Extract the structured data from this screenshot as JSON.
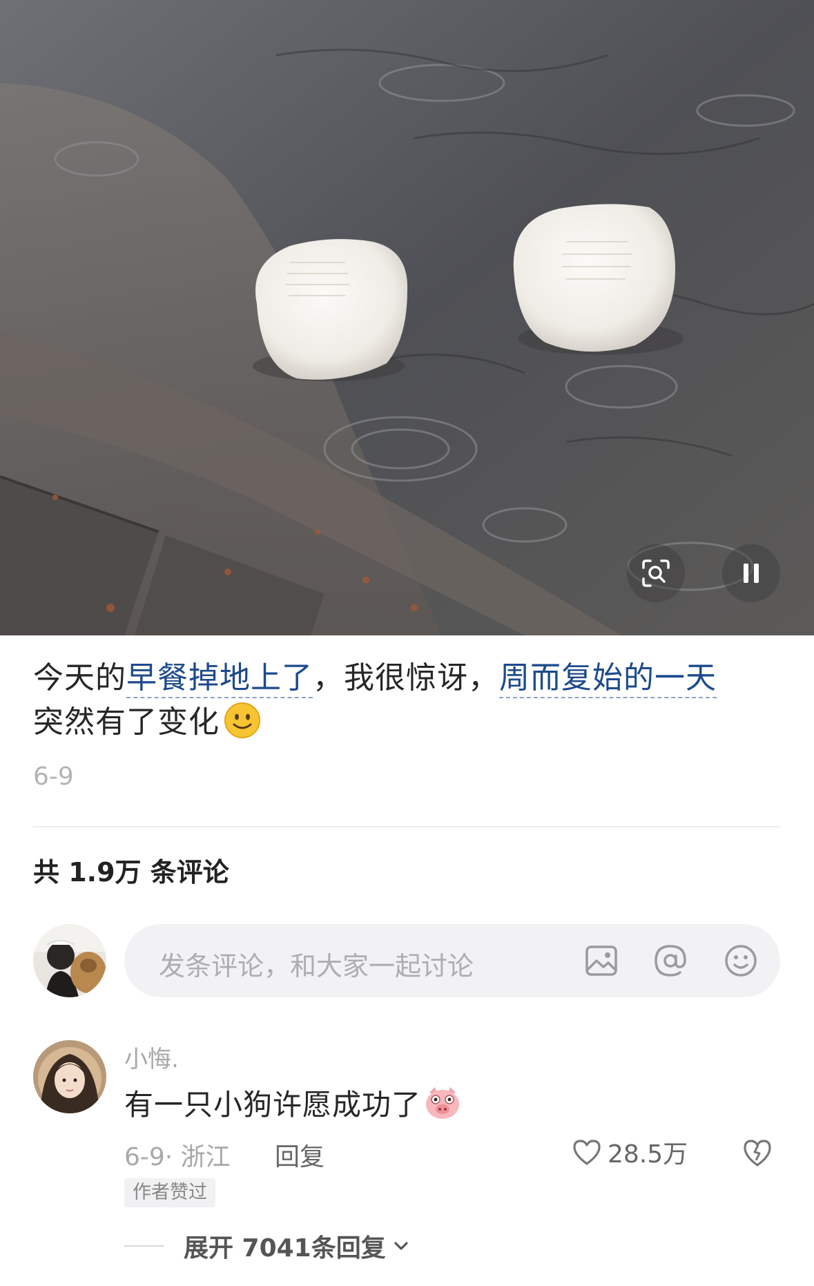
{
  "media": {
    "image_description": "",
    "lens_icon": "lens-search-icon",
    "pause_icon": "pause-icon"
  },
  "post": {
    "caption_part1": "今天的",
    "topic1": "早餐掉地上了",
    "caption_part2": "，我很惊讶，",
    "topic2": "周而复始的一天",
    "caption_part3": "突然有了变化",
    "emoji": "smile-emoji-icon",
    "date": "6-9"
  },
  "comments_header": {
    "count_label": "共 1.9万 条评论"
  },
  "comment_input": {
    "placeholder": "发条评论，和大家一起讨论",
    "icons": [
      "image-icon",
      "at-icon",
      "emoji-icon"
    ]
  },
  "comments": [
    {
      "user": "小悔.",
      "text": "有一只小狗许愿成功了",
      "emoji": "pig-face-emoji-icon",
      "meta": "6-9· 浙江",
      "reply_label": "回复",
      "like_count": "28.5万",
      "badge": "作者赞过",
      "expand_label": "展开 7041条回复"
    }
  ]
}
